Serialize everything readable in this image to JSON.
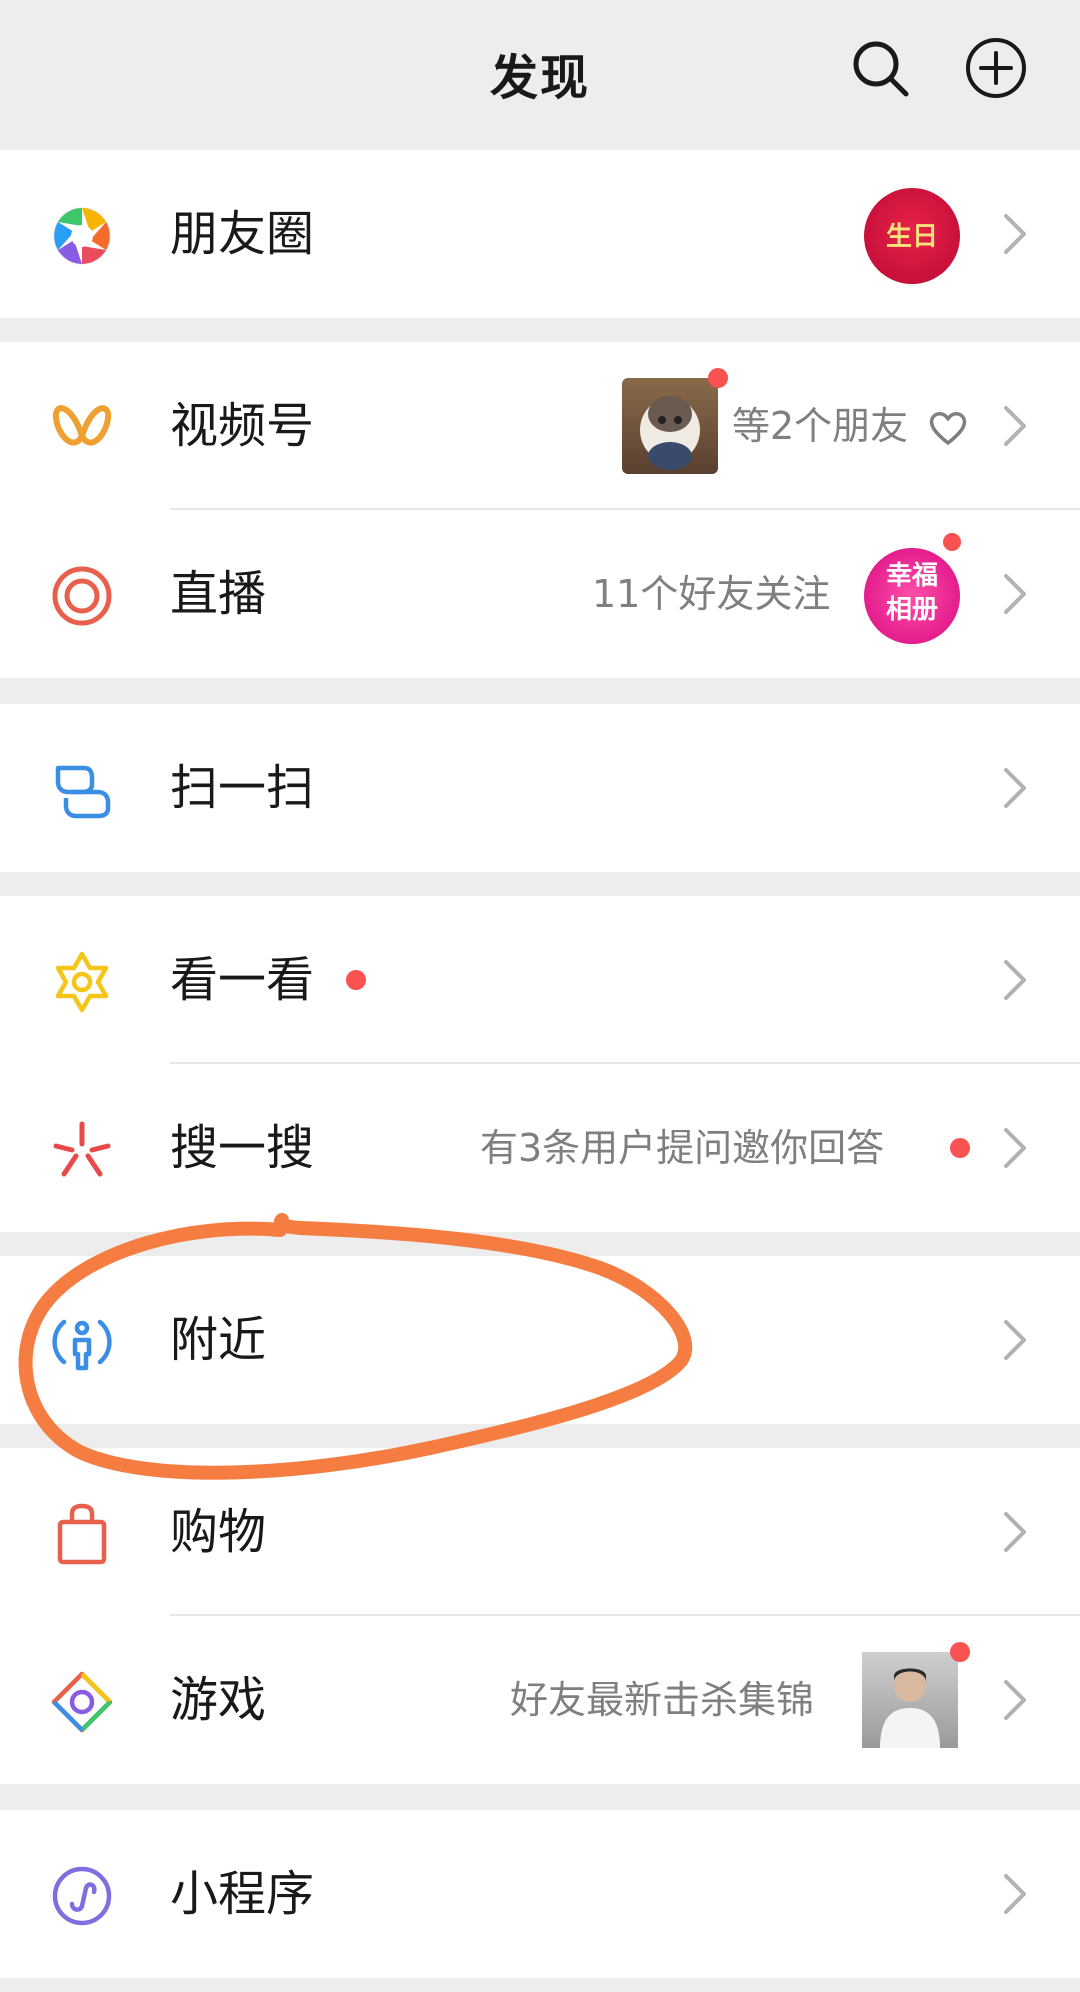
{
  "header": {
    "title": "发现"
  },
  "items": [
    {
      "label": "朋友圈"
    },
    {
      "label": "视频号",
      "sub": "等2个朋友"
    },
    {
      "label": "直播",
      "sub": "11个好友关注",
      "badge_line1": "幸福",
      "badge_line2": "相册"
    },
    {
      "label": "扫一扫"
    },
    {
      "label": "看一看"
    },
    {
      "label": "搜一搜",
      "sub": "有3条用户提问邀你回答"
    },
    {
      "label": "附近"
    },
    {
      "label": "购物"
    },
    {
      "label": "游戏",
      "sub": "好友最新击杀集锦"
    },
    {
      "label": "小程序"
    }
  ],
  "moments_thumb": {
    "text": "生日"
  },
  "colors": {
    "background": "#ededed",
    "row": "#ffffff",
    "red_dot": "#fa5151",
    "annotation": "#f57d42",
    "secondary_text": "#7f7f7f"
  },
  "icons": {
    "moments": "aperture-icon",
    "channels": "butterfly-icon",
    "live": "target-icon",
    "scan": "scan-icon",
    "top_stories": "star-icon",
    "search": "sparkle-icon",
    "nearby": "location-person-icon",
    "shopping": "bag-icon",
    "games": "diamond-icon",
    "mini_programs": "link-icon"
  }
}
